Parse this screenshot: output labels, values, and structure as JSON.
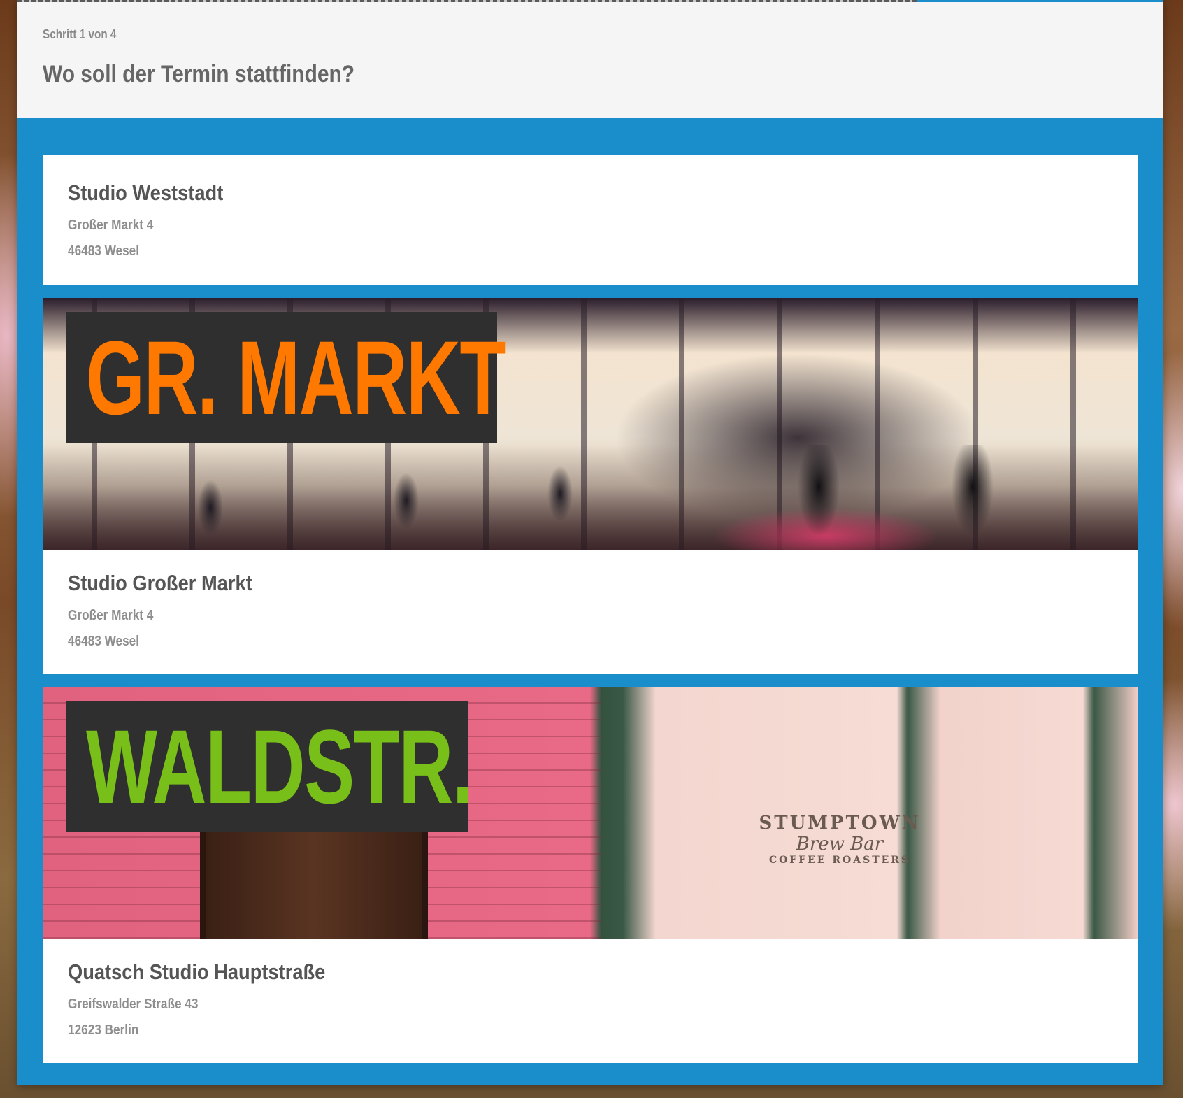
{
  "header": {
    "step": "Schritt 1 von 4",
    "title": "Wo soll der Termin stattfinden?",
    "progress_fraction": 0.25
  },
  "locations": [
    {
      "name": "Studio Weststadt",
      "street": "Großer Markt 4",
      "city": "46483 Wesel"
    },
    {
      "banner_text": "GR. MARKT",
      "banner_color": "#ff7800",
      "name": "Studio Großer Markt",
      "street": "Großer Markt 4",
      "city": "46483 Wesel"
    },
    {
      "banner_text": "WALDSTR.",
      "banner_color": "#78bf19",
      "banner_sign": [
        "STUMPTOWN",
        "Brew Bar",
        "COFFEE ROASTERS"
      ],
      "name": "Quatsch Studio Hauptstraße",
      "street": "Greifswalder Straße 43",
      "city": "12623 Berlin"
    }
  ],
  "colors": {
    "accent": "#1a8dcb",
    "header_bg": "#f5f5f5",
    "card_bg": "#ffffff",
    "title_text": "#666666",
    "muted_text": "#8e8e8e"
  }
}
